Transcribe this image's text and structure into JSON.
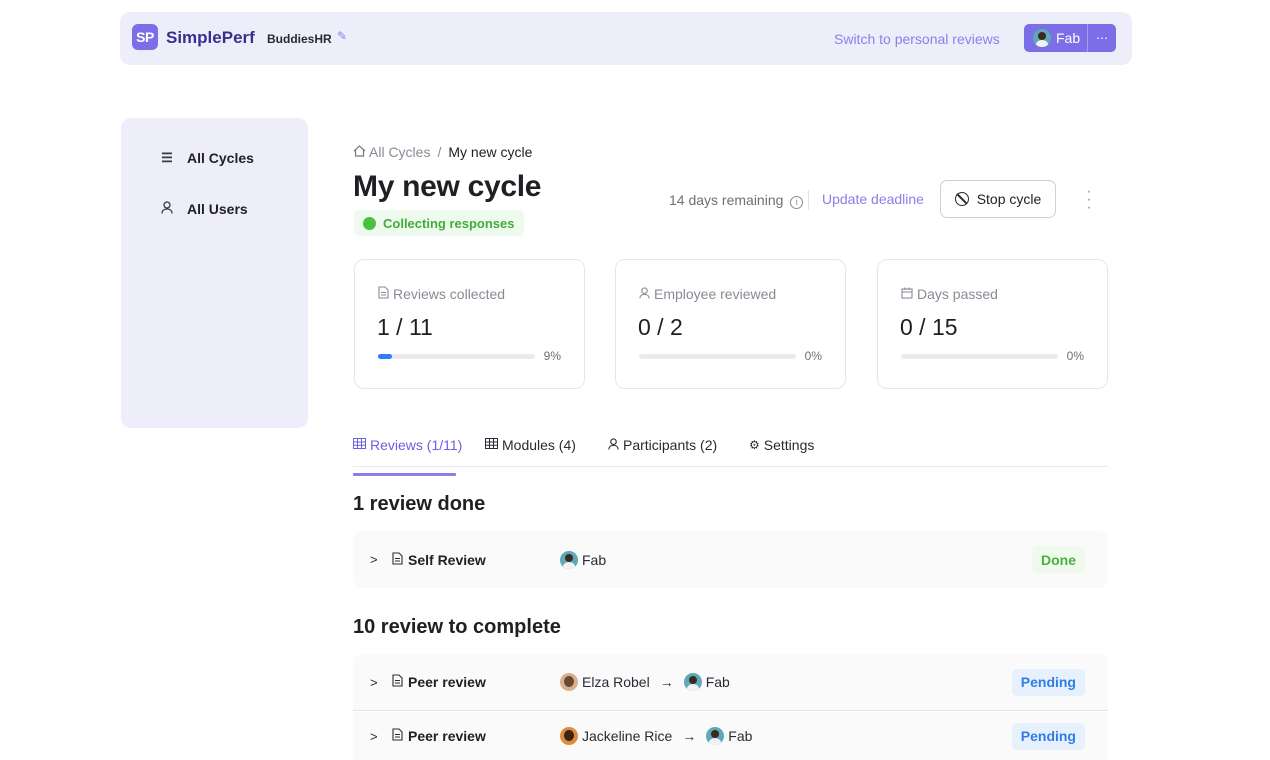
{
  "header": {
    "logo_text": "SP",
    "brand": "SimplePerf",
    "org": "BuddiesHR",
    "switch_link": "Switch to personal reviews",
    "user_name": "Fab",
    "more_label": "⋯"
  },
  "sidebar": {
    "items": [
      {
        "label": "All Cycles",
        "icon": "list-icon"
      },
      {
        "label": "All Users",
        "icon": "user-icon"
      }
    ]
  },
  "breadcrumb": {
    "parent": "All Cycles",
    "separator": "/",
    "current": "My new cycle"
  },
  "cycle": {
    "title": "My new cycle",
    "status": "Collecting responses",
    "remaining": "14 days remaining",
    "update_deadline": "Update deadline",
    "stop_label": "Stop cycle"
  },
  "stats": [
    {
      "label": "Reviews collected",
      "value": "1 / 11",
      "percent_text": "9%",
      "progress": 0.09,
      "icon": "document-icon"
    },
    {
      "label": "Employee reviewed",
      "value": "0 / 2",
      "percent_text": "0%",
      "progress": 0,
      "icon": "user-icon"
    },
    {
      "label": "Days passed",
      "value": "0 / 15",
      "percent_text": "0%",
      "progress": 0,
      "icon": "calendar-icon"
    }
  ],
  "tabs": [
    {
      "label": "Reviews (1/11)",
      "icon": "table-icon",
      "active": true
    },
    {
      "label": "Modules (4)",
      "icon": "table-icon",
      "active": false
    },
    {
      "label": "Participants (2)",
      "icon": "user-icon",
      "active": false
    },
    {
      "label": "Settings",
      "icon": "gear-icon",
      "active": false
    }
  ],
  "sections": {
    "done_title": "1 review done",
    "todo_title": "10 review to complete"
  },
  "reviews_done": [
    {
      "type": "Self Review",
      "reviewer": "Fab",
      "status": "Done"
    }
  ],
  "reviews_todo": [
    {
      "type": "Peer review",
      "reviewer": "Elza Robel",
      "reviewee": "Fab",
      "status": "Pending"
    },
    {
      "type": "Peer review",
      "reviewer": "Jackeline Rice",
      "reviewee": "Fab",
      "status": "Pending"
    }
  ],
  "colors": {
    "accent": "#7c6ee6",
    "done": "#47b23f",
    "pending": "#2f7ee8",
    "progress": "#2e7cf6"
  }
}
